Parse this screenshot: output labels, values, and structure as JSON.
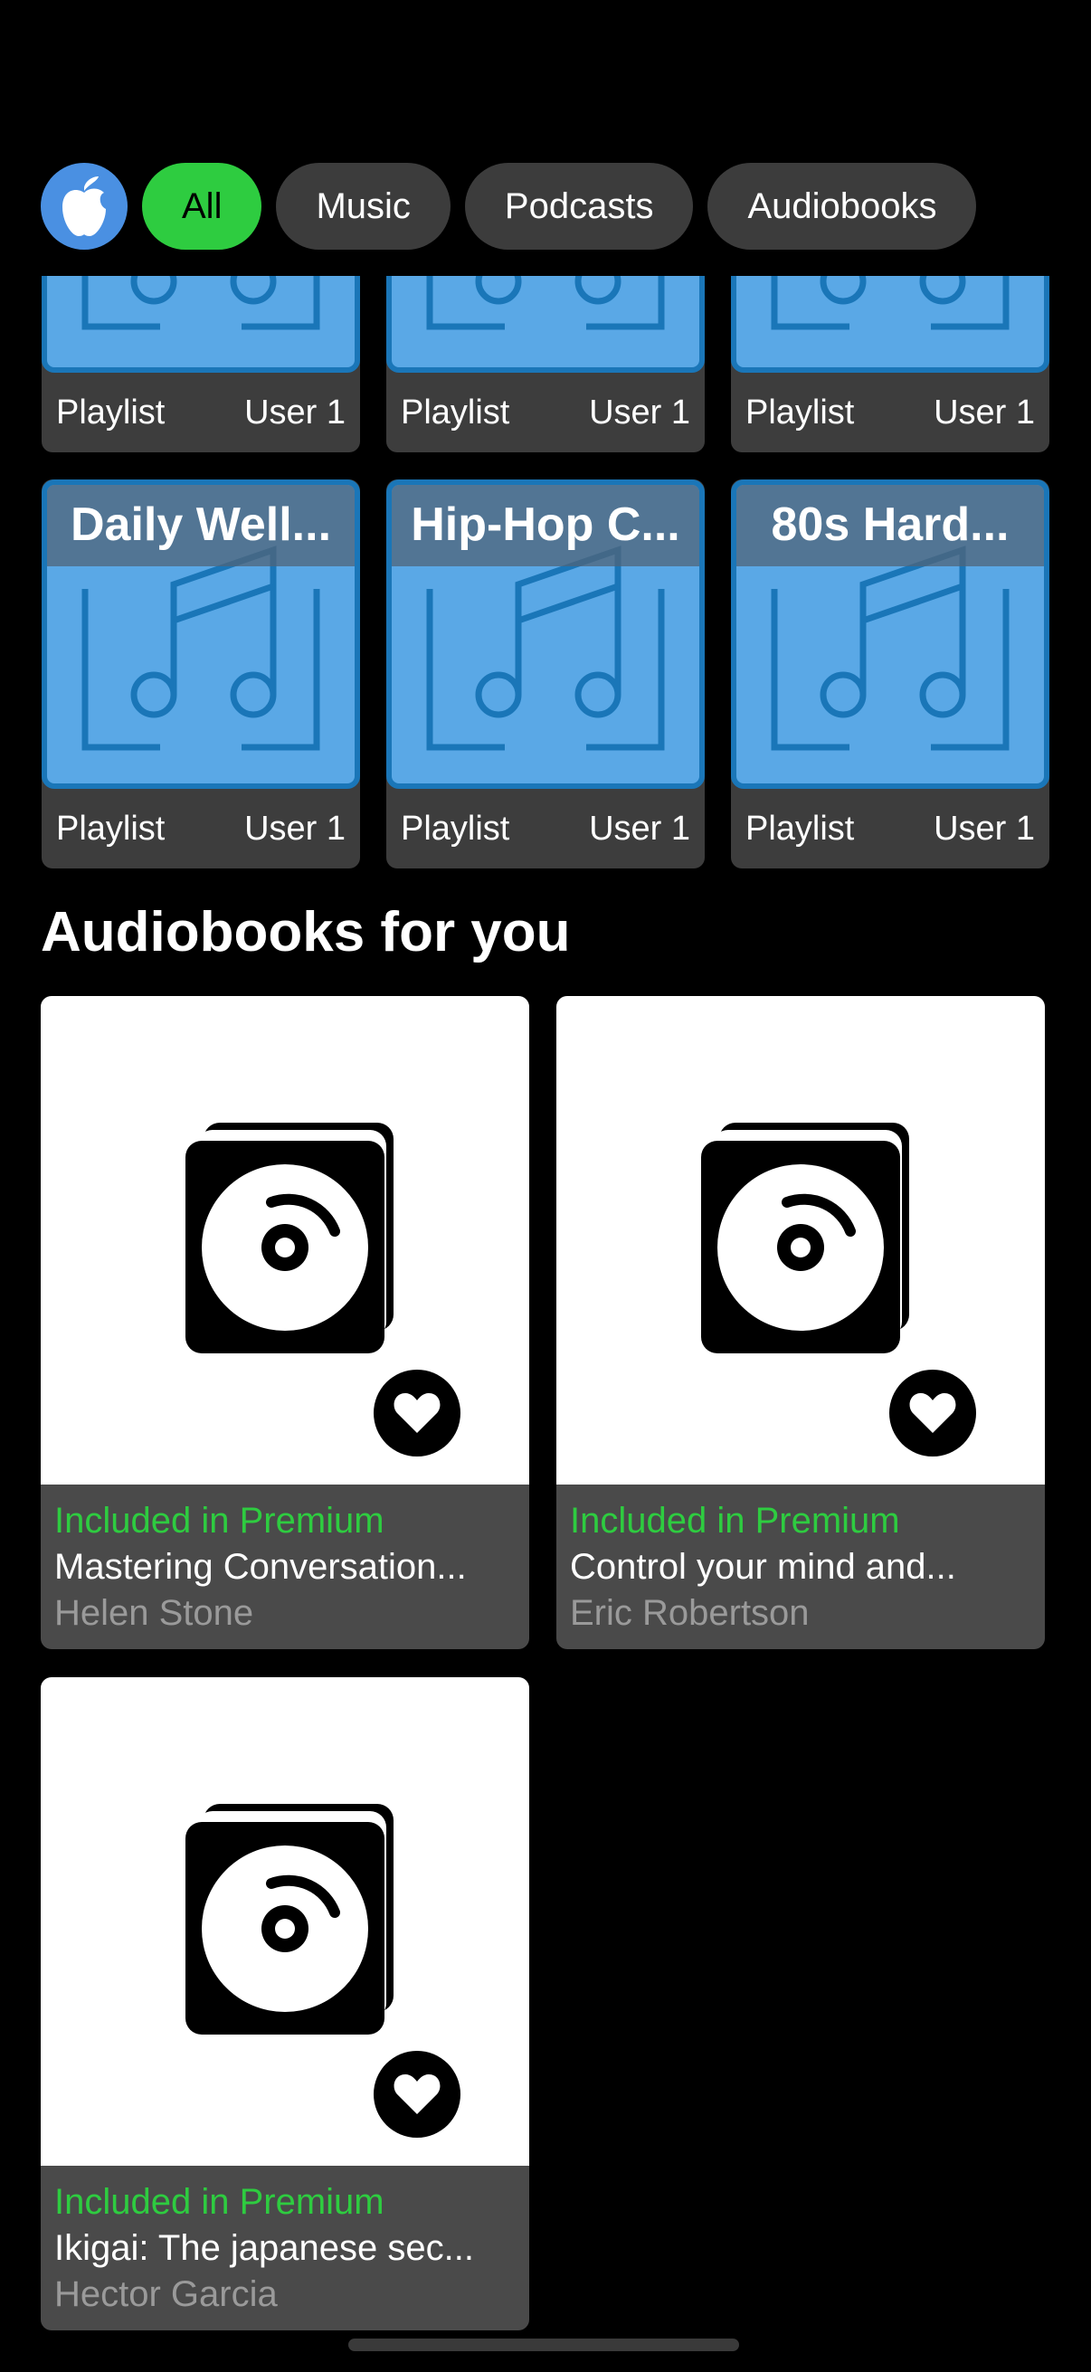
{
  "filters": {
    "avatar_icon": "apple-icon",
    "chips": [
      {
        "label": "All",
        "active": true
      },
      {
        "label": "Music",
        "active": false
      },
      {
        "label": "Podcasts",
        "active": false
      },
      {
        "label": "Audiobooks",
        "active": false
      }
    ]
  },
  "playlists": {
    "row1": [
      {
        "type": "Playlist",
        "owner": "User 1"
      },
      {
        "type": "Playlist",
        "owner": "User 1"
      },
      {
        "type": "Playlist",
        "owner": "User 1"
      }
    ],
    "row2": [
      {
        "title": "Daily Well...",
        "type": "Playlist",
        "owner": "User 1"
      },
      {
        "title": "Hip-Hop C...",
        "type": "Playlist",
        "owner": "User 1"
      },
      {
        "title": "80s Hard...",
        "type": "Playlist",
        "owner": "User 1"
      }
    ]
  },
  "audiobooks": {
    "section_title": "Audiobooks for you",
    "items": [
      {
        "badge": "Included in Premium",
        "title": "Mastering Conversation...",
        "author": "Helen Stone"
      },
      {
        "badge": "Included in Premium",
        "title": "Control your mind and...",
        "author": "Eric Robertson"
      },
      {
        "badge": "Included in Premium",
        "title": "Ikigai: The japanese sec...",
        "author": "Hector Garcia"
      }
    ]
  },
  "colors": {
    "accent_green": "#2ecc40",
    "playlist_blue": "#5aa8e6",
    "avatar_blue": "#4a90e2"
  }
}
